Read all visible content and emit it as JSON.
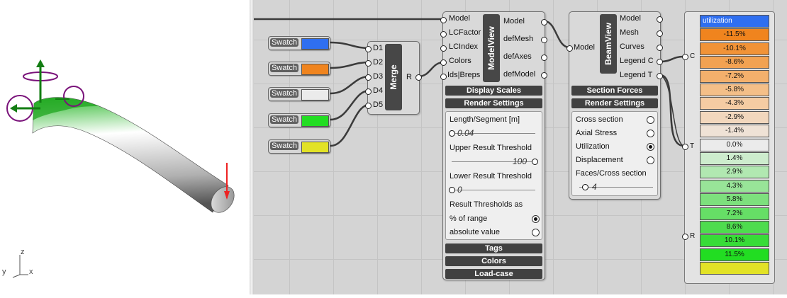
{
  "viewport": {
    "axes": {
      "z": "z",
      "y": "y",
      "x": "x"
    }
  },
  "swatches": [
    {
      "label": "Swatch",
      "color": "#2f6ff0"
    },
    {
      "label": "Swatch",
      "color": "#f0841e"
    },
    {
      "label": "Swatch",
      "color": "#ebebeb"
    },
    {
      "label": "Swatch",
      "color": "#22dd22"
    },
    {
      "label": "Swatch",
      "color": "#e2e226"
    }
  ],
  "merge": {
    "title": "Merge",
    "inputs": [
      "D1",
      "D2",
      "D3",
      "D4",
      "D5"
    ],
    "output": "R"
  },
  "modelview": {
    "title": "ModelView",
    "inputs": [
      "Model",
      "LCFactor",
      "LCIndex",
      "Colors",
      "Ids|Breps"
    ],
    "outputs": [
      "Model",
      "defMesh",
      "defAxes",
      "defModel"
    ],
    "bar_display_scales": "Display Scales",
    "bar_render_settings": "Render Settings",
    "length_label": "Length/Segment [m]",
    "length_value": "0.04",
    "upper_label": "Upper Result Threshold",
    "upper_value": "100",
    "lower_label": "Lower Result Threshold",
    "lower_value": "0",
    "thresholds_as_label": "Result Thresholds as",
    "option_percent": "% of range",
    "option_absolute": "absolute value",
    "bar_tags": "Tags",
    "bar_colors": "Colors",
    "bar_loadcase": "Load-case"
  },
  "beamview": {
    "title": "BeamView",
    "inputs": [
      "Model"
    ],
    "outputs": [
      "Model",
      "Mesh",
      "Curves",
      "Legend C",
      "Legend T"
    ],
    "bar_section_forces": "Section Forces",
    "bar_render_settings": "Render Settings",
    "options": [
      "Cross section",
      "Axial Stress",
      "Utilization",
      "Displacement"
    ],
    "selected_option": "Utilization",
    "faces_label": "Faces/Cross section",
    "faces_value": "4"
  },
  "legend": {
    "pins": [
      "C",
      "T",
      "R"
    ],
    "rows": [
      {
        "text": "utilization",
        "color": "#2f6ff0",
        "textcolor": "#ffffff"
      },
      {
        "text": "-11.5%",
        "color": "#f0841e"
      },
      {
        "text": "-10.1%",
        "color": "#f19337"
      },
      {
        "text": "-8.6%",
        "color": "#f2a252"
      },
      {
        "text": "-7.2%",
        "color": "#f3b06c"
      },
      {
        "text": "-5.8%",
        "color": "#f4bf88"
      },
      {
        "text": "-4.3%",
        "color": "#f5cca3"
      },
      {
        "text": "-2.9%",
        "color": "#f2d7bd"
      },
      {
        "text": "-1.4%",
        "color": "#efe2d6"
      },
      {
        "text": "0.0%",
        "color": "#ebebeb"
      },
      {
        "text": "1.4%",
        "color": "#cdeccd"
      },
      {
        "text": "2.9%",
        "color": "#b1e8b1"
      },
      {
        "text": "4.3%",
        "color": "#98e498"
      },
      {
        "text": "5.8%",
        "color": "#7de07d"
      },
      {
        "text": "7.2%",
        "color": "#66de66"
      },
      {
        "text": "8.6%",
        "color": "#4edc4e"
      },
      {
        "text": "10.1%",
        "color": "#38dc38"
      },
      {
        "text": "11.5%",
        "color": "#22dd22"
      },
      {
        "text": "",
        "color": "#e2e226"
      }
    ]
  }
}
